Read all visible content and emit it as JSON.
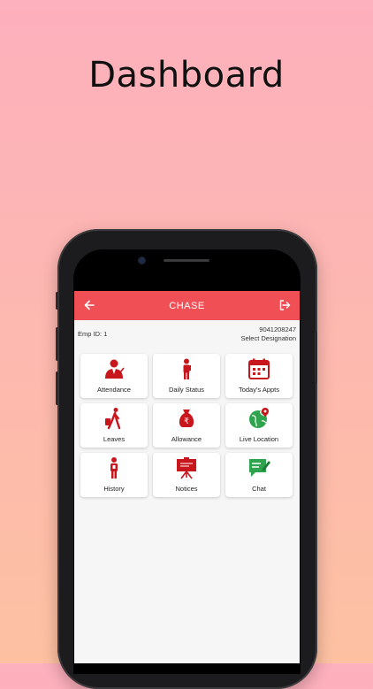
{
  "headline": "Dashboard",
  "appbar": {
    "title": "CHASE"
  },
  "employee": {
    "id_label": "Emp ID: 1",
    "phone": "9041208247",
    "designation": "Select Designation"
  },
  "tiles": [
    {
      "label": "Attendance",
      "icon": "attendance-icon"
    },
    {
      "label": "Daily Status",
      "icon": "daily-status-icon"
    },
    {
      "label": "Today's Appts",
      "icon": "calendar-icon"
    },
    {
      "label": "Leaves",
      "icon": "walking-luggage-icon"
    },
    {
      "label": "Allowance",
      "icon": "rupee-bag-icon"
    },
    {
      "label": "Live Location",
      "icon": "globe-pin-icon"
    },
    {
      "label": "History",
      "icon": "person-history-icon"
    },
    {
      "label": "Notices",
      "icon": "notice-board-icon"
    },
    {
      "label": "Chat",
      "icon": "chat-icon"
    }
  ],
  "colors": {
    "primary": "#f04f55",
    "icon_red": "#c8161d",
    "icon_green": "#2ea44f"
  }
}
